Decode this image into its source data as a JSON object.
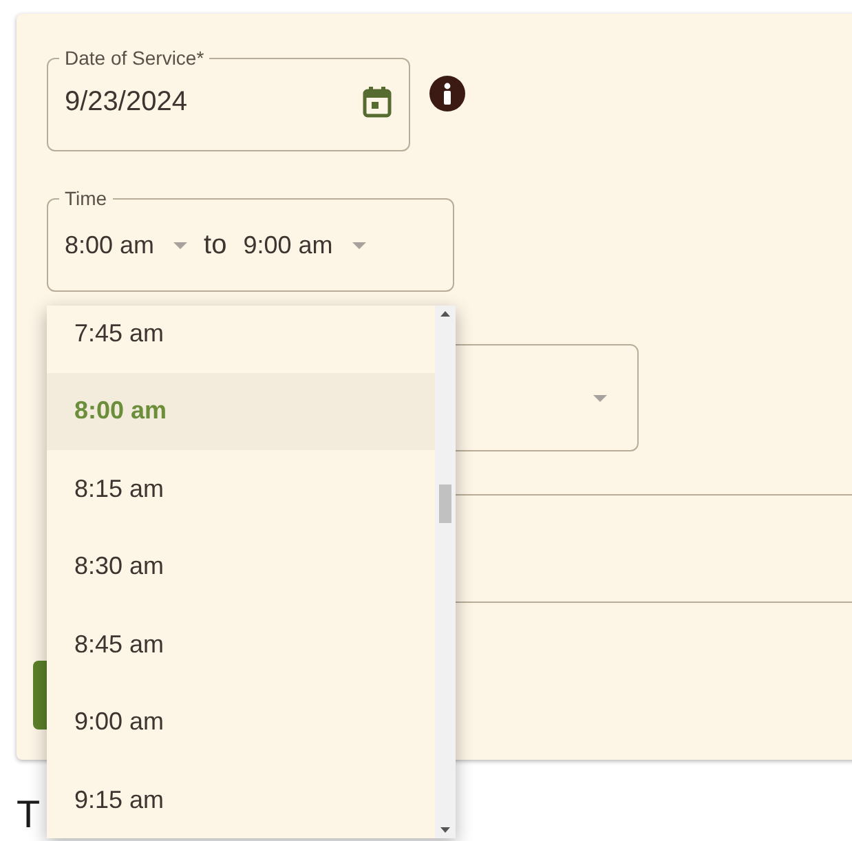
{
  "date_field": {
    "label": "Date of Service*",
    "value": "9/23/2024"
  },
  "time_field": {
    "label": "Time",
    "start": "8:00 am",
    "separator": "to",
    "end": "9:00 am"
  },
  "time_options": [
    {
      "label": "7:45 am",
      "selected": false
    },
    {
      "label": "8:00 am",
      "selected": true
    },
    {
      "label": "8:15 am",
      "selected": false
    },
    {
      "label": "8:30 am",
      "selected": false
    },
    {
      "label": "8:45 am",
      "selected": false
    },
    {
      "label": "9:00 am",
      "selected": false
    },
    {
      "label": "9:15 am",
      "selected": false
    }
  ],
  "heading": "T"
}
